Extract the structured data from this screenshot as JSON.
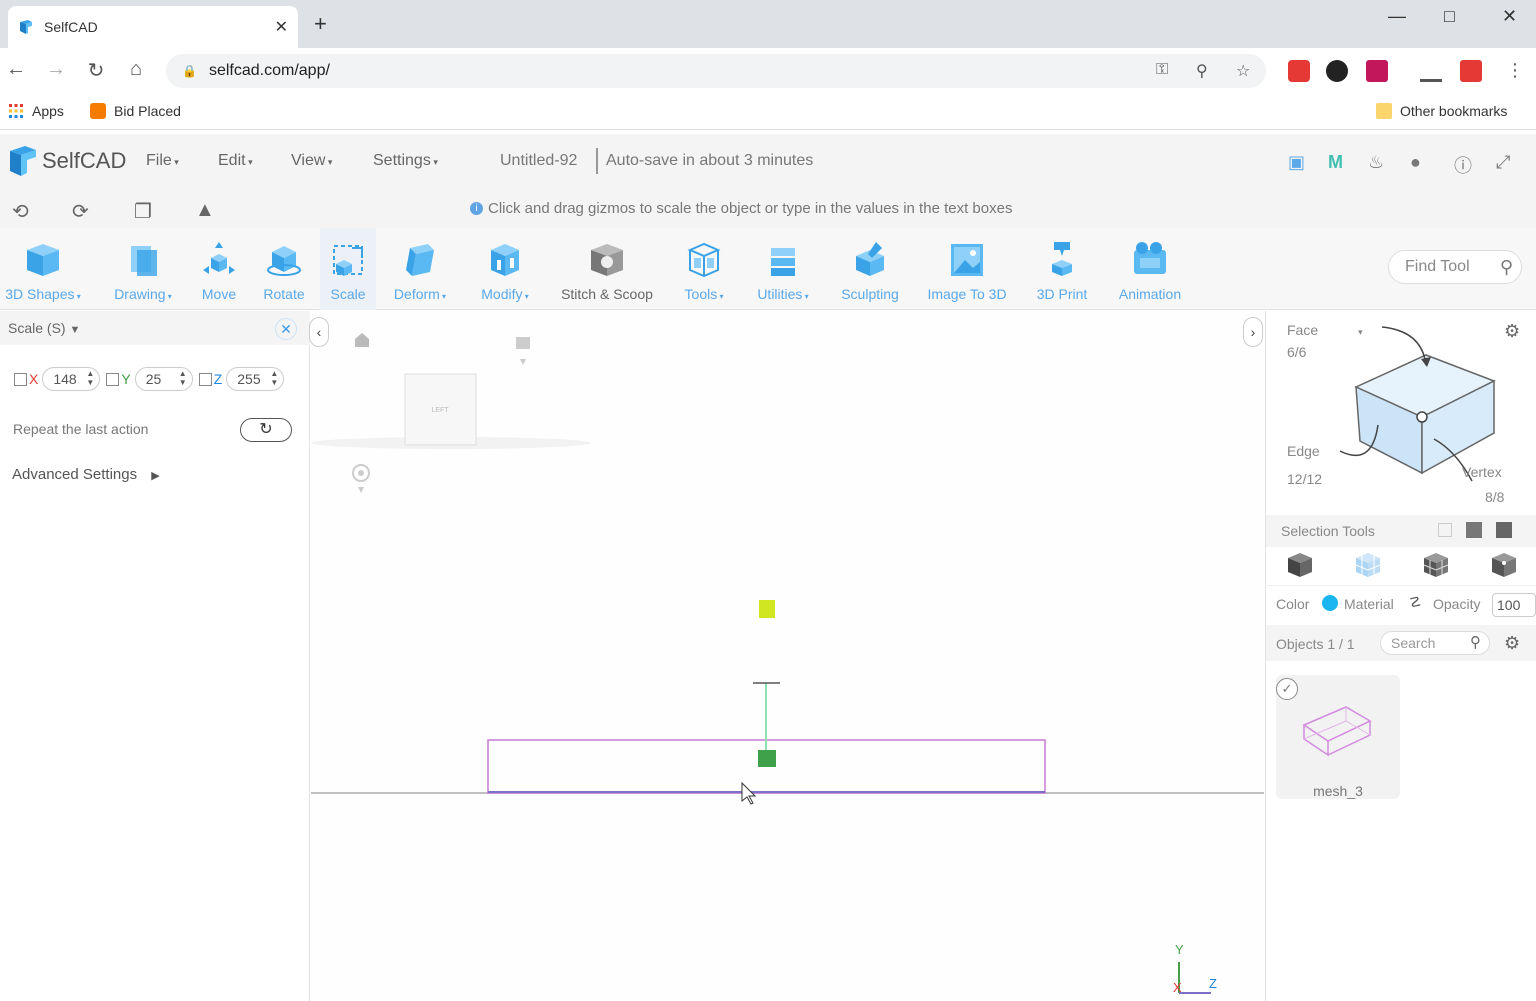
{
  "browser": {
    "tab_title": "SelfCAD",
    "tab_close": "✕",
    "new_tab": "+",
    "url": "selfcad.com/app/",
    "bookmarks": [
      {
        "label": "Apps"
      },
      {
        "label": "Bid Placed"
      }
    ],
    "other_bookmarks": "Other bookmarks"
  },
  "app": {
    "logo_text": "SelfCAD",
    "menus": [
      "File",
      "Edit",
      "View",
      "Settings"
    ],
    "doc_title": "Untitled-92",
    "autosave": "Auto-save in about 3 minutes",
    "hint": "Click and drag gizmos to scale the object or type in the values in the text boxes",
    "accent_color": "#5aa8e8"
  },
  "toolbar": {
    "tools": [
      {
        "label": "3D Shapes",
        "dropdown": true
      },
      {
        "label": "Drawing",
        "dropdown": true
      },
      {
        "label": "Move",
        "dropdown": false
      },
      {
        "label": "Rotate",
        "dropdown": false
      },
      {
        "label": "Scale",
        "dropdown": false,
        "active": true
      },
      {
        "label": "Deform",
        "dropdown": true
      },
      {
        "label": "Modify",
        "dropdown": true
      },
      {
        "label": "Stitch & Scoop",
        "dropdown": false
      },
      {
        "label": "Tools",
        "dropdown": true
      },
      {
        "label": "Utilities",
        "dropdown": true
      },
      {
        "label": "Sculpting",
        "dropdown": false
      },
      {
        "label": "Image To 3D",
        "dropdown": false
      },
      {
        "label": "3D Print",
        "dropdown": false
      },
      {
        "label": "Animation",
        "dropdown": false
      }
    ],
    "find_tool_placeholder": "Find Tool"
  },
  "scale_panel": {
    "title": "Scale (S)",
    "x_label": "X",
    "y_label": "Y",
    "z_label": "Z",
    "x_value": "148",
    "y_value": "25",
    "z_value": "255",
    "repeat_label": "Repeat the last action",
    "advanced_label": "Advanced Settings"
  },
  "viewport": {
    "cube_face_label": "LEFT",
    "axis_y": "Y",
    "axis_x": "X",
    "axis_z": "Z"
  },
  "right_panel": {
    "face_label": "Face",
    "face_count": "6/6",
    "edge_label": "Edge",
    "edge_count": "12/12",
    "vertex_label": "Vertex",
    "vertex_count": "8/8",
    "selection_tools_label": "Selection Tools",
    "color_label": "Color",
    "color_value": "#1ab6f2",
    "material_label": "Material",
    "opacity_label": "Opacity",
    "opacity_value": "100",
    "objects_label": "Objects 1 / 1",
    "search_placeholder": "Search",
    "object_name": "mesh_3"
  }
}
